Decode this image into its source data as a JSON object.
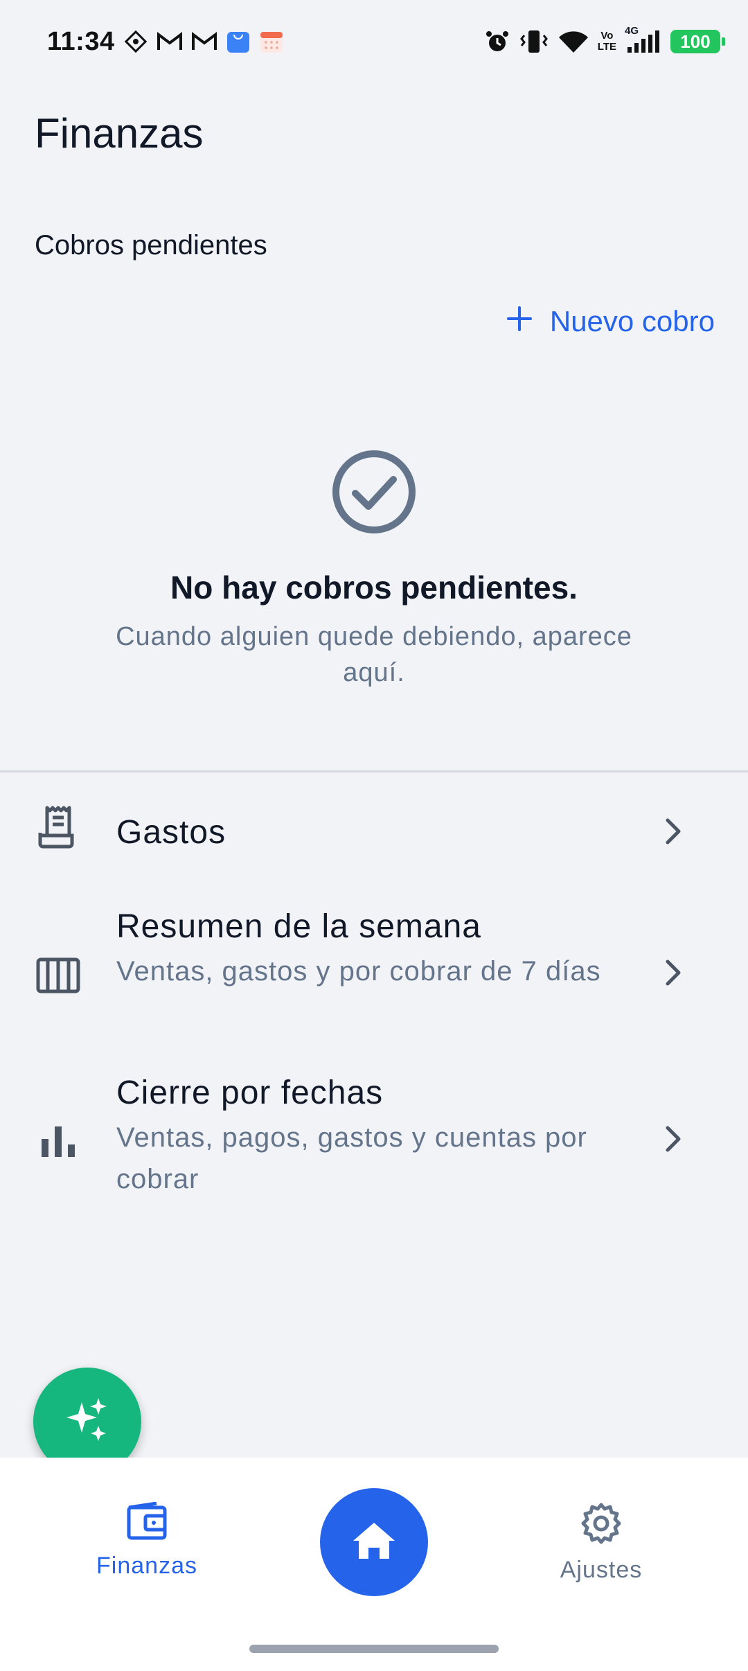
{
  "status_bar": {
    "time": "11:34",
    "battery": "100",
    "network_top": "Vo",
    "network_bottom": "LTE",
    "signal_label": "4G"
  },
  "page": {
    "title": "Finanzas"
  },
  "pending": {
    "section_label": "Cobros pendientes",
    "new_button_label": "Nuevo cobro",
    "empty_title": "No hay cobros pendientes.",
    "empty_subtitle": "Cuando alguien quede debiendo, aparece aquí."
  },
  "menu": [
    {
      "icon": "receipt-icon",
      "title": "Gastos",
      "subtitle": ""
    },
    {
      "icon": "calendar-week-icon",
      "title": "Resumen de la semana",
      "subtitle": "Ventas, gastos y por cobrar de 7 días"
    },
    {
      "icon": "bar-chart-icon",
      "title": "Cierre por fechas",
      "subtitle": "Ventas, pagos, gastos y cuentas por cobrar"
    }
  ],
  "bottom_nav": {
    "finanzas_label": "Finanzas",
    "ajustes_label": "Ajustes"
  },
  "colors": {
    "accent": "#2563eb",
    "fab": "#16b67f",
    "muted": "#64748b",
    "background": "#f1f3f6"
  }
}
